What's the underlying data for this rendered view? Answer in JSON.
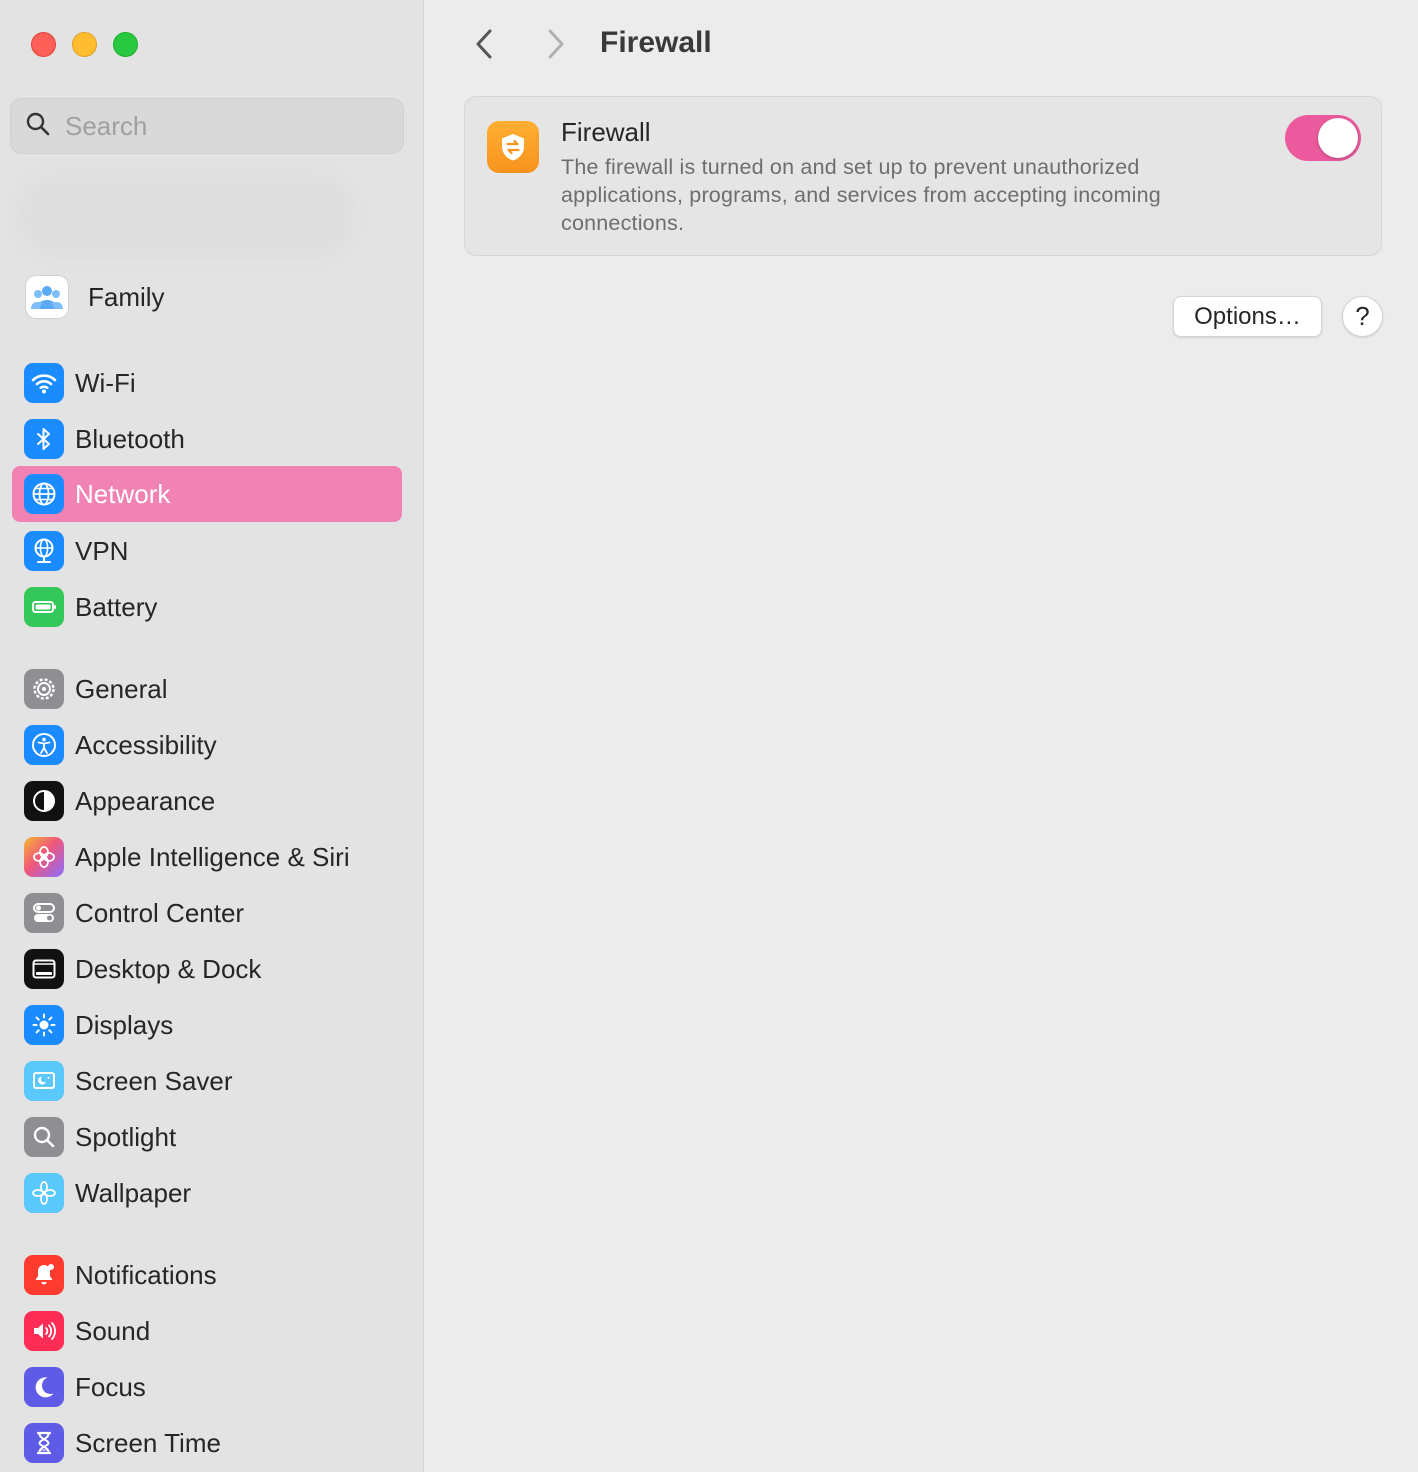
{
  "window": {
    "traffic_lights": [
      "close",
      "minimize",
      "zoom"
    ]
  },
  "sidebar": {
    "search_placeholder": "Search",
    "family_label": "Family",
    "groups": [
      {
        "items": [
          {
            "id": "wifi",
            "label": "Wi-Fi",
            "icon": "wifi-icon",
            "color": "#1a8cff"
          },
          {
            "id": "bluetooth",
            "label": "Bluetooth",
            "icon": "bluetooth-icon",
            "color": "#1a8cff"
          },
          {
            "id": "network",
            "label": "Network",
            "icon": "globe-icon",
            "color": "#1a8cff",
            "selected": true
          },
          {
            "id": "vpn",
            "label": "VPN",
            "icon": "vpn-globe-icon",
            "color": "#1a8cff"
          },
          {
            "id": "battery",
            "label": "Battery",
            "icon": "battery-icon",
            "color": "#34c759"
          }
        ]
      },
      {
        "items": [
          {
            "id": "general",
            "label": "General",
            "icon": "gear-icon",
            "color": "#8e8e93"
          },
          {
            "id": "accessibility",
            "label": "Accessibility",
            "icon": "accessibility-icon",
            "color": "#1a8cff"
          },
          {
            "id": "appearance",
            "label": "Appearance",
            "icon": "appearance-icon",
            "color": "#111111"
          },
          {
            "id": "siri",
            "label": "Apple Intelligence & Siri",
            "icon": "apple-intelligence-icon",
            "color": "#f08a5d"
          },
          {
            "id": "control-center",
            "label": "Control Center",
            "icon": "toggles-icon",
            "color": "#8e8e93"
          },
          {
            "id": "desktop-dock",
            "label": "Desktop & Dock",
            "icon": "dock-icon",
            "color": "#111111"
          },
          {
            "id": "displays",
            "label": "Displays",
            "icon": "sun-icon",
            "color": "#1a8cff"
          },
          {
            "id": "screen-saver",
            "label": "Screen Saver",
            "icon": "screen-saver-icon",
            "color": "#5ac8fa"
          },
          {
            "id": "spotlight",
            "label": "Spotlight",
            "icon": "magnifier-icon",
            "color": "#8e8e93"
          },
          {
            "id": "wallpaper",
            "label": "Wallpaper",
            "icon": "flower-icon",
            "color": "#5ac8fa"
          }
        ]
      },
      {
        "items": [
          {
            "id": "notifications",
            "label": "Notifications",
            "icon": "bell-icon",
            "color": "#ff3b30"
          },
          {
            "id": "sound",
            "label": "Sound",
            "icon": "speaker-icon",
            "color": "#ff2d55"
          },
          {
            "id": "focus",
            "label": "Focus",
            "icon": "moon-icon",
            "color": "#5e5ce6"
          },
          {
            "id": "screen-time",
            "label": "Screen Time",
            "icon": "hourglass-icon",
            "color": "#5e5ce6"
          }
        ]
      }
    ]
  },
  "main": {
    "title": "Firewall",
    "card": {
      "title": "Firewall",
      "description": "The firewall is turned on and set up to prevent unauthorized applications, programs, and services from accepting incoming connections.",
      "toggle_on": true
    },
    "options_label": "Options…",
    "help_label": "?"
  },
  "colors": {
    "accent_pink": "#eb5a9d",
    "selected_row": "#f183b4",
    "firewall_orange": "#f7931e"
  }
}
